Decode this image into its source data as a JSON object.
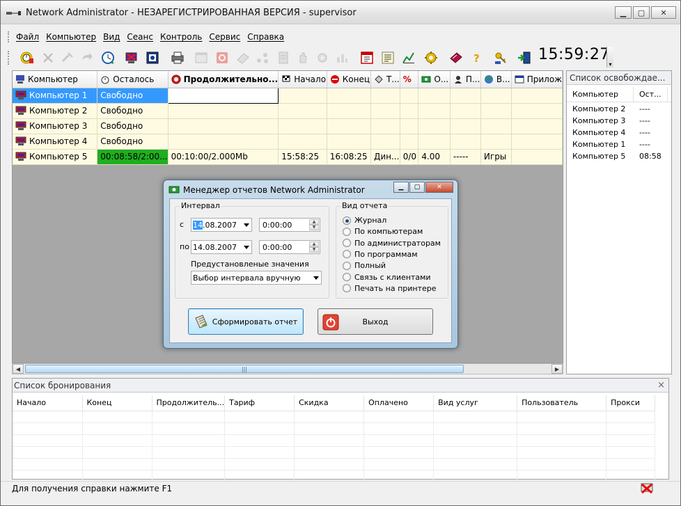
{
  "window": {
    "title": "Network Administrator - НЕЗАРЕГИСТРИРОВАННАЯ ВЕРСИЯ - supervisor"
  },
  "menu": [
    "Файл",
    "Компьютер",
    "Вид",
    "Сеанс",
    "Контроль",
    "Сервис",
    "Справка"
  ],
  "toolbar": {
    "clock": "15:59:27"
  },
  "grid": {
    "columns": [
      "Компьютер",
      "Осталось",
      "Продолжительно...",
      "Начало",
      "Конец",
      "Т...",
      "%",
      "О...",
      "П...",
      "В...",
      "Прилож"
    ],
    "rows": [
      [
        "Компьютер 1",
        "Свободно",
        "",
        "",
        "",
        "",
        "",
        "",
        "",
        "",
        ""
      ],
      [
        "Компьютер 2",
        "Свободно",
        "",
        "",
        "",
        "",
        "",
        "",
        "",
        "",
        ""
      ],
      [
        "Компьютер 3",
        "Свободно",
        "",
        "",
        "",
        "",
        "",
        "",
        "",
        "",
        ""
      ],
      [
        "Компьютер 4",
        "Свободно",
        "",
        "",
        "",
        "",
        "",
        "",
        "",
        "",
        ""
      ],
      [
        "Компьютер 5",
        "00:08:58/2:00...",
        "00:10:00/2.000Mb",
        "15:58:25",
        "16:08:25",
        "Дин...",
        "0/0",
        "4.00",
        "-----",
        "Игры",
        ""
      ]
    ]
  },
  "release_panel": {
    "title": "Список освобождае...",
    "columns": [
      "Компьютер",
      "Ост..."
    ],
    "rows": [
      [
        "Компьютер 2",
        "----"
      ],
      [
        "Компьютер 3",
        "----"
      ],
      [
        "Компьютер 4",
        "----"
      ],
      [
        "Компьютер 1",
        "----"
      ],
      [
        "Компьютер 5",
        "08:58"
      ]
    ]
  },
  "booking": {
    "title": "Список бронирования",
    "close": "×",
    "columns": [
      "Начало",
      "Конец",
      "Продолжитель...",
      "Тариф",
      "Скидка",
      "Оплачено",
      "Вид услуг",
      "Пользователь",
      "Прокси"
    ]
  },
  "status": {
    "text": "Для получения справки нажмите F1"
  },
  "dialog": {
    "title": "Менеджер отчетов Network Administrator",
    "interval_label": "Интервал",
    "from_label": "с",
    "to_label": "по",
    "from_date_sel": "14",
    "from_date_rest": ".08.2007",
    "from_time": "0:00:00",
    "to_date": "14.08.2007",
    "to_time": "0:00:00",
    "preset_label": "Предустановленые значения",
    "preset_value": "Выбор интервала вручную",
    "report_type_label": "Вид отчета",
    "report_types": [
      "Журнал",
      "По компьютерам",
      "По администраторам",
      "По программам",
      "Полный",
      "Связь с клиентами",
      "Печать на принтере"
    ],
    "selected_report_type": "Журнал",
    "generate_button": "Сформировать отчет",
    "exit_button": "Выход"
  }
}
